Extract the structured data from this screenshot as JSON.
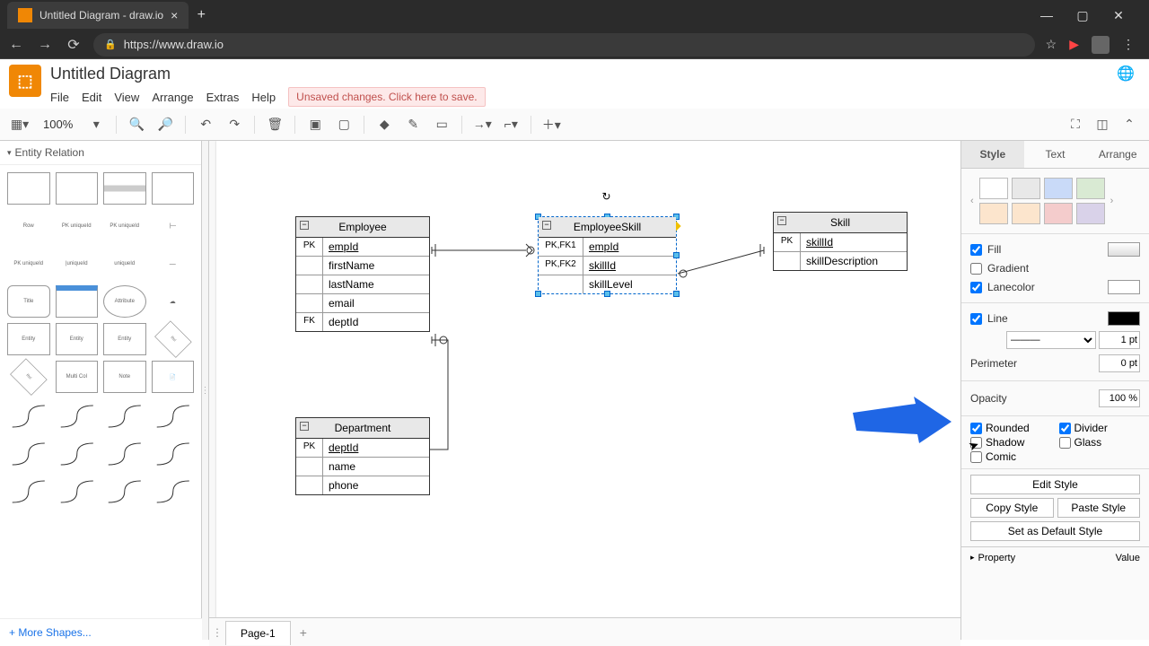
{
  "browser": {
    "tab_title": "Untitled Diagram - draw.io",
    "url": "https://www.draw.io"
  },
  "app": {
    "title": "Untitled Diagram",
    "menus": [
      "File",
      "Edit",
      "View",
      "Arrange",
      "Extras",
      "Help"
    ],
    "unsaved_msg": "Unsaved changes. Click here to save."
  },
  "toolbar": {
    "zoom": "100%"
  },
  "palette": {
    "title": "Entity Relation",
    "row_label": "Row",
    "more": "More Shapes..."
  },
  "canvas": {
    "entities": {
      "employee": {
        "name": "Employee",
        "rows": [
          {
            "key": "PK",
            "field": "empId",
            "underline": true
          },
          {
            "key": "",
            "field": "firstName"
          },
          {
            "key": "",
            "field": "lastName"
          },
          {
            "key": "",
            "field": "email"
          },
          {
            "key": "FK",
            "field": "deptId"
          }
        ]
      },
      "employeeSkill": {
        "name": "EmployeeSkill",
        "rows": [
          {
            "key": "PK,FK1",
            "field": "empId",
            "underline": true
          },
          {
            "key": "PK,FK2",
            "field": "skillId",
            "underline": true
          },
          {
            "key": "",
            "field": "skillLevel"
          }
        ]
      },
      "skill": {
        "name": "Skill",
        "rows": [
          {
            "key": "PK",
            "field": "skillId",
            "underline": true
          },
          {
            "key": "",
            "field": "skillDescription"
          }
        ]
      },
      "department": {
        "name": "Department",
        "rows": [
          {
            "key": "PK",
            "field": "deptId",
            "underline": true
          },
          {
            "key": "",
            "field": "name"
          },
          {
            "key": "",
            "field": "phone"
          }
        ]
      }
    }
  },
  "right": {
    "tabs": {
      "style": "Style",
      "text": "Text",
      "arrange": "Arrange"
    },
    "swatches": [
      "#ffffff",
      "#e8e8e8",
      "#c9daf8",
      "#d9ead3",
      "#fce5cd",
      "#f4cccc",
      "#f4cccc",
      "#d9d2e9"
    ],
    "fill": "Fill",
    "gradient": "Gradient",
    "lanecolor": "Lanecolor",
    "line": "Line",
    "line_width": "1 pt",
    "perimeter": "Perimeter",
    "perimeter_val": "0 pt",
    "opacity": "Opacity",
    "opacity_val": "100 %",
    "rounded": "Rounded",
    "divider": "Divider",
    "shadow": "Shadow",
    "glass": "Glass",
    "comic": "Comic",
    "edit_style": "Edit Style",
    "copy_style": "Copy Style",
    "paste_style": "Paste Style",
    "default_style": "Set as Default Style",
    "property": "Property",
    "value": "Value"
  },
  "pages": {
    "current": "Page-1"
  }
}
